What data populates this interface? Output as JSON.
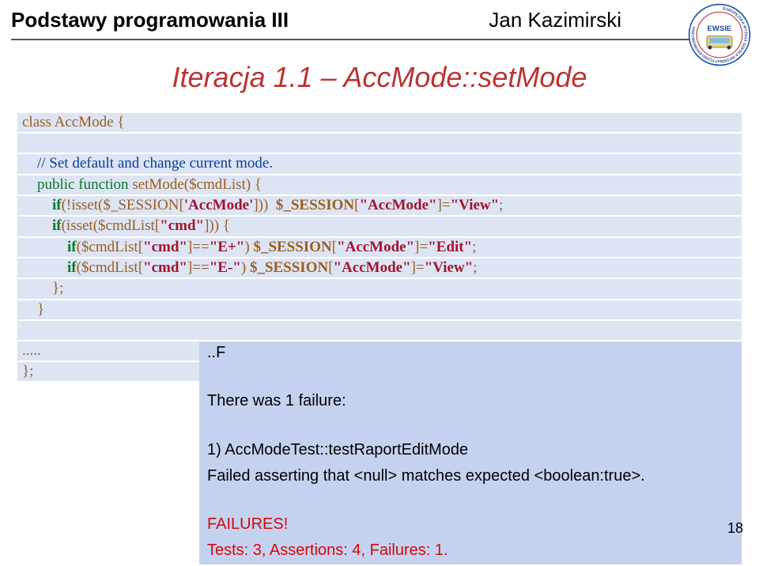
{
  "header": {
    "left": "Podstawy programowania III",
    "right": "Jan Kazimirski"
  },
  "logo": {
    "outer_text": "EUROPEJSKA WYŻSZA SZKOŁA INFORMATYCZNO-EKONOMICZNA",
    "inner_text": "EWSIE"
  },
  "title": "Iteracja 1.1 – AccMode::setMode",
  "code": {
    "l01": "class AccMode {",
    "l02": "",
    "l03a": "    ",
    "l03b": "// Set default and change current mode.",
    "l04a": "    public function",
    "l04b": " setMode",
    "l04c": "($cmdList) {",
    "l05a": "        if",
    "l05b": "(!isset($_SESSION[",
    "l05c": "'AccMode'",
    "l05d": "]))  ",
    "l05e": "$_SESSION",
    "l05f": "[",
    "l05g": "\"AccMode\"",
    "l05h": "]=",
    "l05i": "\"View\"",
    "l05j": ";",
    "l06a": "        if",
    "l06b": "(isset($cmdList[",
    "l06c": "\"cmd\"",
    "l06d": "])) {",
    "l07a": "            if",
    "l07b": "($cmdList[",
    "l07c": "\"cmd\"",
    "l07d": "]==",
    "l07e": "\"E+\"",
    "l07f": ") ",
    "l07g": "$_SESSION",
    "l07h": "[",
    "l07i": "\"AccMode\"",
    "l07j": "]=",
    "l07k": "\"Edit\"",
    "l07l": ";",
    "l08a": "            if",
    "l08b": "($cmdList[",
    "l08c": "\"cmd\"",
    "l08d": "]==",
    "l08e": "\"E-\"",
    "l08f": ") ",
    "l08g": "$_SESSION",
    "l08h": "[",
    "l08i": "\"AccMode\"",
    "l08j": "]=",
    "l08k": "\"View\"",
    "l08l": ";",
    "l09": "        };",
    "l10": "    }",
    "l11": "",
    "l12": ".....",
    "l13": "};"
  },
  "result": {
    "r1": "..F",
    "r2": "There was 1 failure:",
    "r3": "1) AccModeTest::testRaportEditMode",
    "r4": "Failed asserting that <null> matches expected <boolean:true>.",
    "r5": "FAILURES!",
    "r6": "Tests: 3, Assertions: 4, Failures: 1."
  },
  "page_number": "18"
}
